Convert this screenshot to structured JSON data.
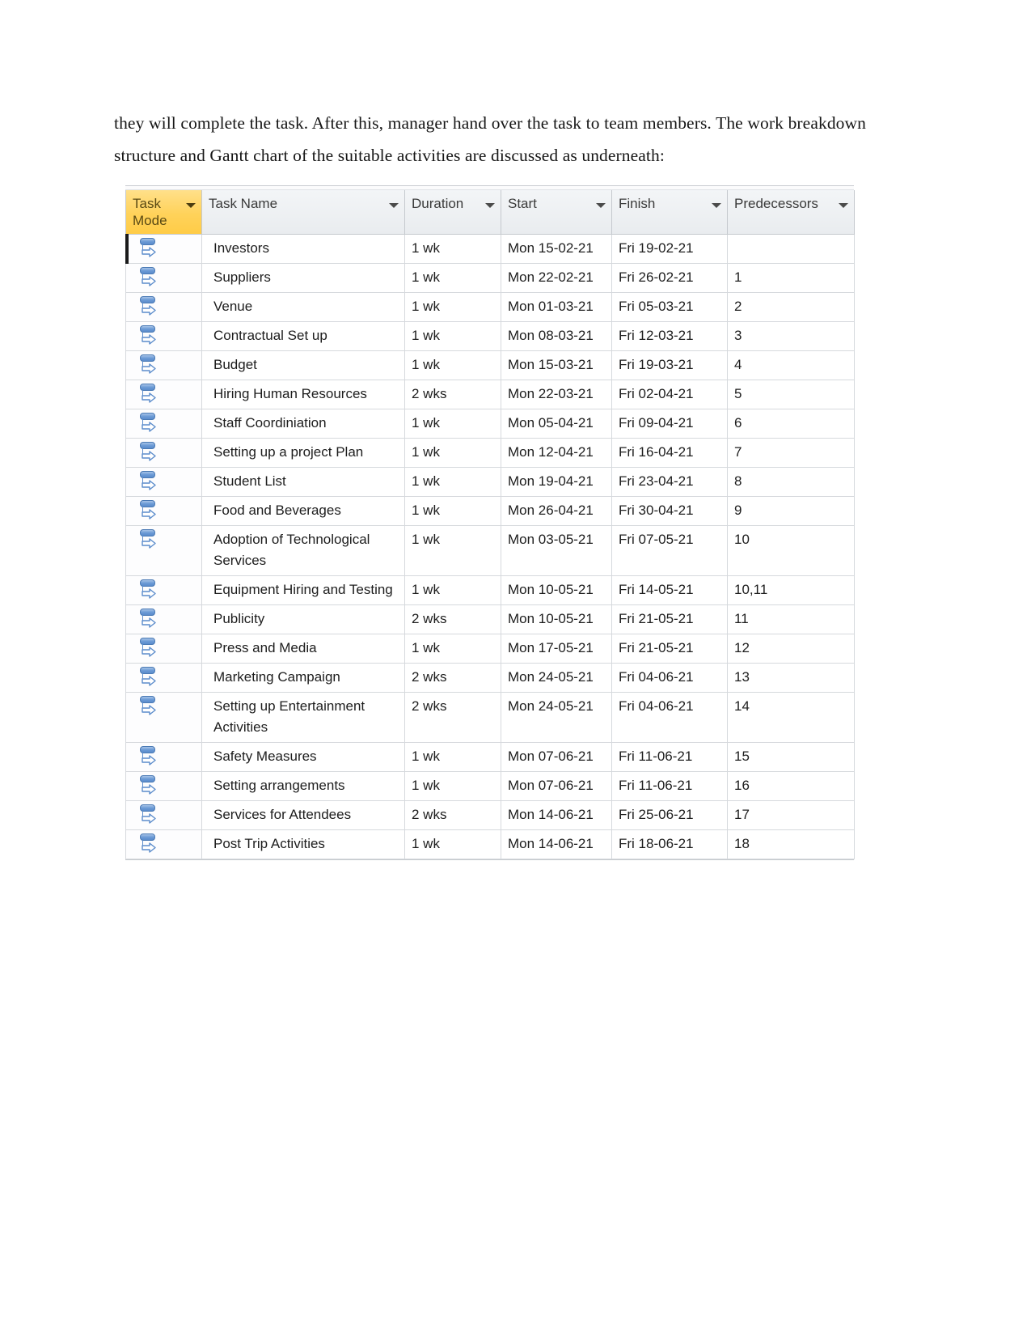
{
  "document": {
    "paragraph": "they will complete the task. After this, manager hand over the task to team members. The work breakdown structure and Gantt chart of the suitable activities are discussed as underneath:"
  },
  "project_table": {
    "columns": [
      {
        "key": "mode",
        "label": "Task\nMode",
        "icon": "filter-arrow-icon",
        "highlighted": true,
        "highlight_color": "#ffcc47"
      },
      {
        "key": "name",
        "label": "Task Name",
        "icon": "filter-arrow-icon",
        "highlighted": false
      },
      {
        "key": "dur",
        "label": "Duration",
        "icon": "filter-arrow-icon",
        "highlighted": false
      },
      {
        "key": "start",
        "label": "Start",
        "icon": "filter-arrow-icon",
        "highlighted": false
      },
      {
        "key": "finish",
        "label": "Finish",
        "icon": "filter-arrow-icon",
        "highlighted": false
      },
      {
        "key": "pred",
        "label": "Predecessors",
        "icon": "filter-arrow-icon",
        "highlighted": false
      }
    ],
    "task_mode_icon": "auto-scheduled-icon",
    "rows": [
      {
        "name": "Investors",
        "dur": "1 wk",
        "start": "Mon 15-02-21",
        "finish": "Fri 19-02-21",
        "pred": "",
        "selected": true
      },
      {
        "name": "Suppliers",
        "dur": "1 wk",
        "start": "Mon 22-02-21",
        "finish": "Fri 26-02-21",
        "pred": "1",
        "selected": false
      },
      {
        "name": "Venue",
        "dur": "1 wk",
        "start": "Mon 01-03-21",
        "finish": "Fri 05-03-21",
        "pred": "2",
        "selected": false
      },
      {
        "name": "Contractual Set up",
        "dur": "1 wk",
        "start": "Mon 08-03-21",
        "finish": "Fri 12-03-21",
        "pred": "3",
        "selected": false
      },
      {
        "name": "Budget",
        "dur": "1 wk",
        "start": "Mon 15-03-21",
        "finish": "Fri 19-03-21",
        "pred": "4",
        "selected": false
      },
      {
        "name": "Hiring Human Resources",
        "dur": "2 wks",
        "start": "Mon 22-03-21",
        "finish": "Fri 02-04-21",
        "pred": "5",
        "selected": false
      },
      {
        "name": "Staff Coordiniation",
        "dur": "1 wk",
        "start": "Mon 05-04-21",
        "finish": "Fri 09-04-21",
        "pred": "6",
        "selected": false
      },
      {
        "name": "Setting up a project Plan",
        "dur": "1 wk",
        "start": "Mon 12-04-21",
        "finish": "Fri 16-04-21",
        "pred": "7",
        "selected": false
      },
      {
        "name": "Student List",
        "dur": "1 wk",
        "start": "Mon 19-04-21",
        "finish": "Fri 23-04-21",
        "pred": "8",
        "selected": false
      },
      {
        "name": "Food and Beverages",
        "dur": "1 wk",
        "start": "Mon 26-04-21",
        "finish": "Fri 30-04-21",
        "pred": "9",
        "selected": false
      },
      {
        "name": "Adoption of Technological Services",
        "dur": "1 wk",
        "start": "Mon 03-05-21",
        "finish": "Fri 07-05-21",
        "pred": "10",
        "selected": false
      },
      {
        "name": "Equipment Hiring and Testing",
        "dur": "1 wk",
        "start": "Mon 10-05-21",
        "finish": "Fri 14-05-21",
        "pred": "10,11",
        "selected": false
      },
      {
        "name": "Publicity",
        "dur": "2 wks",
        "start": "Mon 10-05-21",
        "finish": "Fri 21-05-21",
        "pred": "11",
        "selected": false
      },
      {
        "name": "Press and Media",
        "dur": "1 wk",
        "start": "Mon 17-05-21",
        "finish": "Fri 21-05-21",
        "pred": "12",
        "selected": false
      },
      {
        "name": "Marketing Campaign",
        "dur": "2 wks",
        "start": "Mon 24-05-21",
        "finish": "Fri 04-06-21",
        "pred": "13",
        "selected": false
      },
      {
        "name": "Setting up Entertainment Activities",
        "dur": "2 wks",
        "start": "Mon 24-05-21",
        "finish": "Fri 04-06-21",
        "pred": "14",
        "selected": false
      },
      {
        "name": "Safety Measures",
        "dur": "1 wk",
        "start": "Mon 07-06-21",
        "finish": "Fri 11-06-21",
        "pred": "15",
        "selected": false
      },
      {
        "name": "Setting arrangements",
        "dur": "1 wk",
        "start": "Mon 07-06-21",
        "finish": "Fri 11-06-21",
        "pred": "16",
        "selected": false
      },
      {
        "name": "Services for Attendees",
        "dur": "2 wks",
        "start": "Mon 14-06-21",
        "finish": "Fri 25-06-21",
        "pred": "17",
        "selected": false
      },
      {
        "name": "Post Trip Activities",
        "dur": "1 wk",
        "start": "Mon 14-06-21",
        "finish": "Fri 18-06-21",
        "pred": "18",
        "selected": false
      }
    ]
  }
}
